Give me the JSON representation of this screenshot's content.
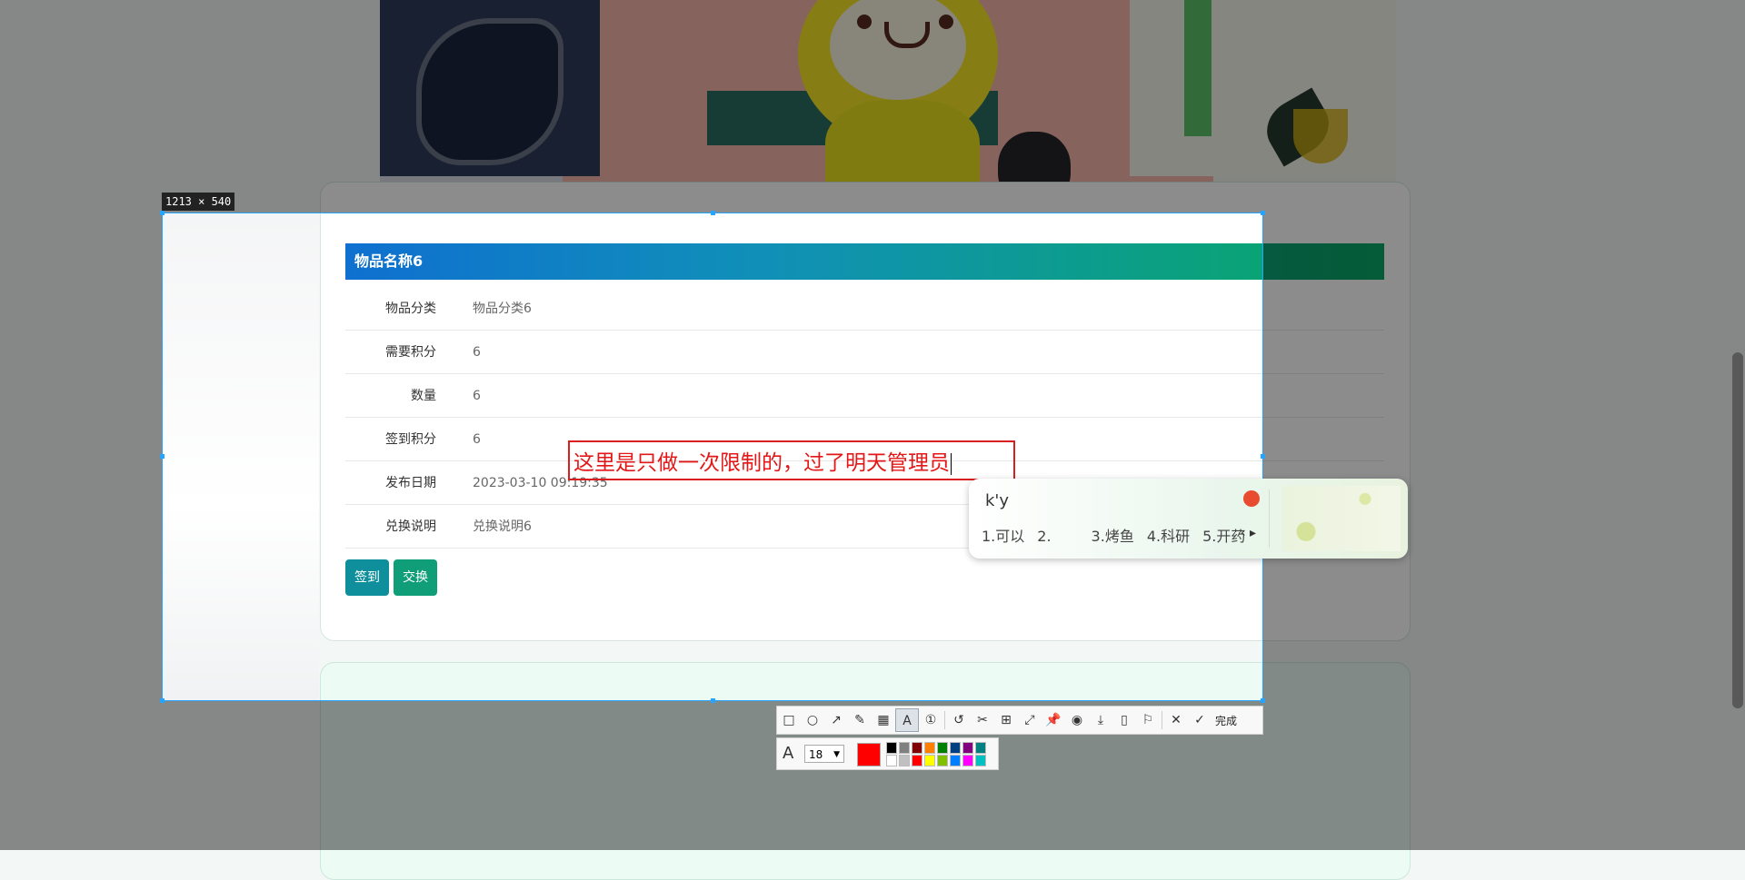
{
  "selection": {
    "size_label": "1213 × 540"
  },
  "item": {
    "title": "物品名称6",
    "fields": [
      {
        "label": "物品分类",
        "value": "物品分类6"
      },
      {
        "label": "需要积分",
        "value": "6"
      },
      {
        "label": "数量",
        "value": "6"
      },
      {
        "label": "签到积分",
        "value": "6"
      },
      {
        "label": "发布日期",
        "value": "2023-03-10 09:19:35"
      },
      {
        "label": "兑换说明",
        "value": "兑换说明6"
      }
    ],
    "buttons": {
      "sign_in": "签到",
      "exchange": "交换"
    }
  },
  "annotation": {
    "text": "这里是只做一次限制的，过了明天管理员"
  },
  "ime": {
    "input": "k'y",
    "candidates": [
      "1.可以",
      "2.",
      "3.烤鱼",
      "4.科研",
      "5.开药"
    ]
  },
  "toolbar": {
    "done_label": "完成",
    "font_size": "18",
    "current_color": "#ff0000",
    "palette": [
      "#000000",
      "#808080",
      "#800000",
      "#ff8000",
      "#008000",
      "#004080",
      "#800080",
      "#008080",
      "#ffffff",
      "#c0c0c0",
      "#ff0000",
      "#ffff00",
      "#80c000",
      "#0080ff",
      "#ff00ff",
      "#00c0c0"
    ]
  },
  "colors": {
    "header_start": "#0f70d0",
    "header_end": "#09a865",
    "selection_border": "#26a4ff",
    "annotation": "#e31717"
  }
}
